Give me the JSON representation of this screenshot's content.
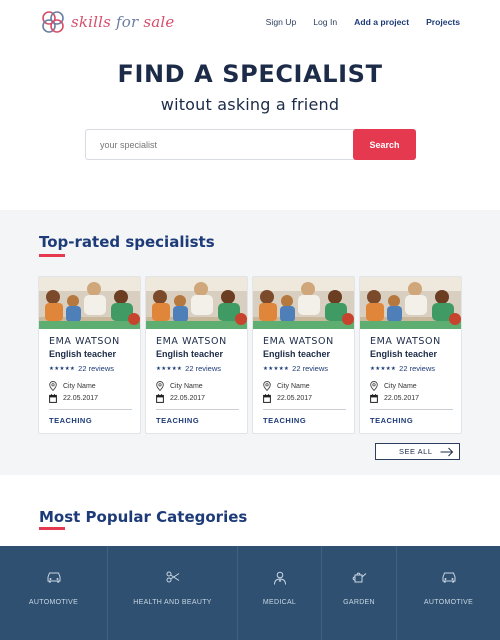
{
  "brand": {
    "logo_part1": "skills",
    "logo_part2": "for",
    "logo_part3": "sale"
  },
  "nav": [
    {
      "label": "Sign Up"
    },
    {
      "label": "Log In"
    },
    {
      "label": "Add a project"
    },
    {
      "label": "Projects"
    }
  ],
  "hero": {
    "title": "FIND A SPECIALIST",
    "subtitle": "witout asking a friend",
    "search_placeholder": "your specialist",
    "search_button": "Search"
  },
  "top_rated": {
    "title": "Top-rated specialists",
    "cards": [
      {
        "name": "EMA  WATSON",
        "role": "English teacher",
        "stars": 5,
        "reviews": "22 reviews",
        "city": "City Name",
        "date": "22.05.2017",
        "category": "TEACHING"
      },
      {
        "name": "EMA  WATSON",
        "role": "English teacher",
        "stars": 5,
        "reviews": "22 reviews",
        "city": "City Name",
        "date": "22.05.2017",
        "category": "TEACHING"
      },
      {
        "name": "EMA  WATSON",
        "role": "English teacher",
        "stars": 5,
        "reviews": "22 reviews",
        "city": "City Name",
        "date": "22.05.2017",
        "category": "TEACHING"
      },
      {
        "name": "EMA  WATSON",
        "role": "English teacher",
        "stars": 5,
        "reviews": "22 reviews",
        "city": "City Name",
        "date": "22.05.2017",
        "category": "TEACHING"
      }
    ],
    "see_all": "SEE ALL"
  },
  "categories": {
    "title": "Most Popular Categories",
    "items": [
      {
        "label": "AUTOMOTIVE",
        "icon": "car-icon"
      },
      {
        "label": "HEALTH AND BEAUTY",
        "icon": "scissors-icon"
      },
      {
        "label": "MEDICAL",
        "icon": "doctor-icon"
      },
      {
        "label": "GARDEN",
        "icon": "watering-can-icon"
      },
      {
        "label": "AUTOMOTIVE",
        "icon": "car-icon"
      }
    ]
  },
  "colors": {
    "accent": "#e5394f",
    "navy": "#1d3b78",
    "category_strip": "#2f5070",
    "section_bg": "#f4f5f6"
  }
}
